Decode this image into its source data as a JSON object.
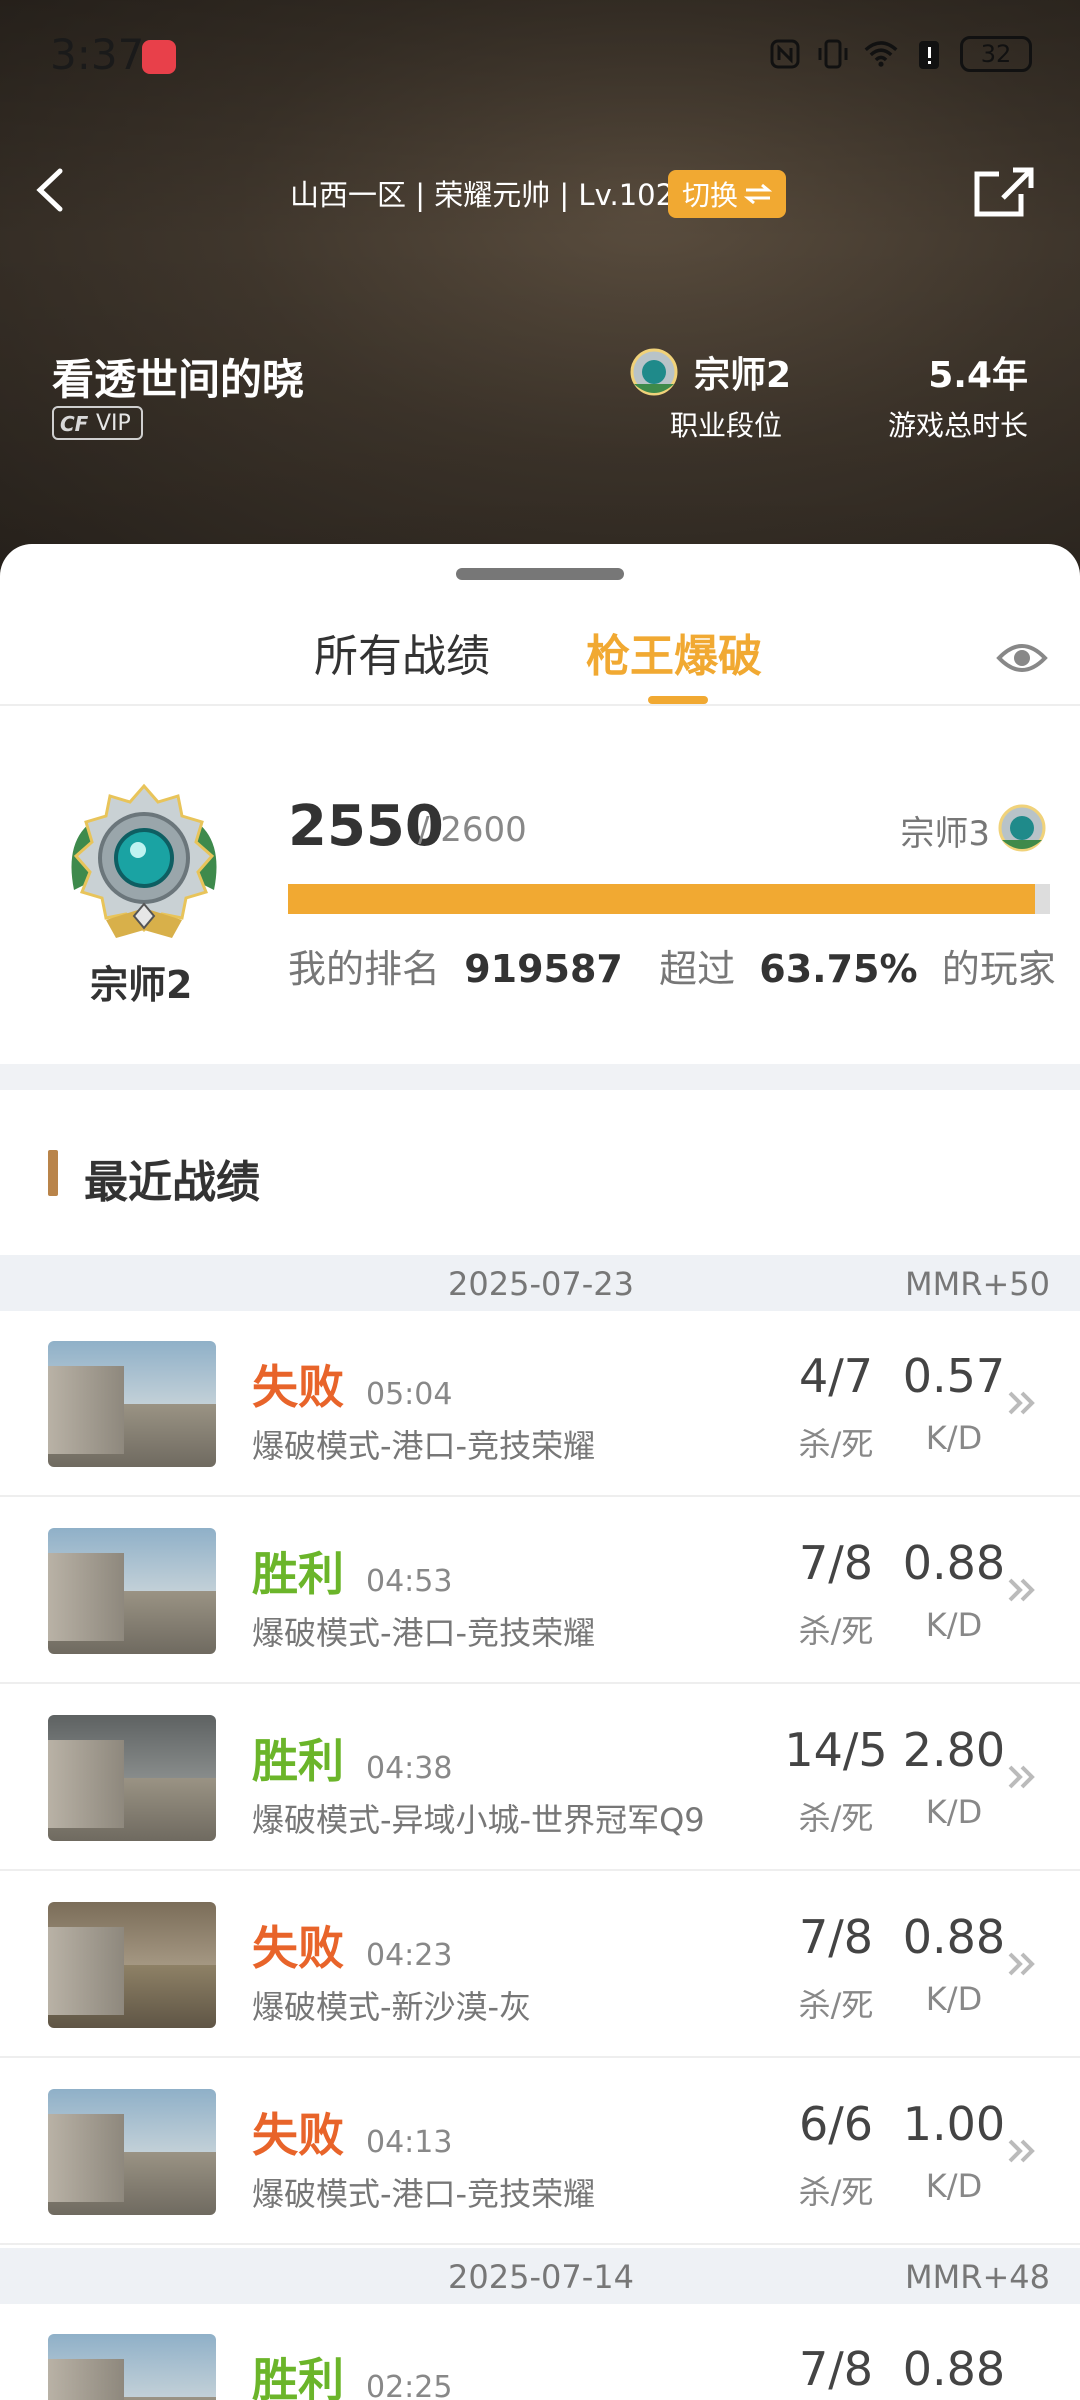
{
  "status_bar": {
    "time": "3:37",
    "battery": "32"
  },
  "header": {
    "server_info": "山西一区 | 荣耀元帅 | Lv.102",
    "switch_label": "切换",
    "player_name": "看透世间的晓",
    "vip_label": "VIP",
    "vip_prefix": "CF",
    "rank_value": "宗师2",
    "rank_label": "职业段位",
    "playtime_value": "5.4年",
    "playtime_label": "游戏总时长"
  },
  "tabs": [
    {
      "label": "所有战绩",
      "active": false
    },
    {
      "label": "枪王爆破",
      "active": true
    }
  ],
  "rank_panel": {
    "current_rank": "宗师2",
    "score": "2550",
    "score_max": "/ 2600",
    "next_rank": "宗师3",
    "progress_fraction": 0.98,
    "rank_prefix": "我的排名",
    "rank_number": "919587",
    "exceed_prefix": "超过",
    "exceed_percent": "63.75%",
    "exceed_suffix": "的玩家"
  },
  "recent": {
    "title": "最近战绩",
    "groups": [
      {
        "date": "2025-07-23",
        "mmr": "MMR+50",
        "matches": [
          {
            "result": "失败",
            "outcome": "lose",
            "time": "05:04",
            "mode": "爆破模式-港口-竞技荣耀",
            "kd_count": "4/7",
            "kd_count_label": "杀/死",
            "kd_ratio": "0.57",
            "kd_ratio_label": "K/D",
            "map": "port"
          },
          {
            "result": "胜利",
            "outcome": "win",
            "time": "04:53",
            "mode": "爆破模式-港口-竞技荣耀",
            "kd_count": "7/8",
            "kd_count_label": "杀/死",
            "kd_ratio": "0.88",
            "kd_ratio_label": "K/D",
            "map": "port"
          },
          {
            "result": "胜利",
            "outcome": "win",
            "time": "04:38",
            "mode": "爆破模式-异域小城-世界冠军Q9",
            "kd_count": "14/5",
            "kd_count_label": "杀/死",
            "kd_ratio": "2.80",
            "kd_ratio_label": "K/D",
            "map": "indoor"
          },
          {
            "result": "失败",
            "outcome": "lose",
            "time": "04:23",
            "mode": "爆破模式-新沙漠-灰",
            "kd_count": "7/8",
            "kd_count_label": "杀/死",
            "kd_ratio": "0.88",
            "kd_ratio_label": "K/D",
            "map": "desert"
          },
          {
            "result": "失败",
            "outcome": "lose",
            "time": "04:13",
            "mode": "爆破模式-港口-竞技荣耀",
            "kd_count": "6/6",
            "kd_count_label": "杀/死",
            "kd_ratio": "1.00",
            "kd_ratio_label": "K/D",
            "map": "port"
          }
        ]
      },
      {
        "date": "2025-07-14",
        "mmr": "MMR+48",
        "matches": [
          {
            "result": "胜利",
            "outcome": "win",
            "time": "02:25",
            "kd_count": "7/8",
            "kd_ratio": "0.88",
            "map": "port"
          }
        ]
      }
    ]
  },
  "colors": {
    "accent": "#f1a932",
    "lose": "#e8642a",
    "win": "#6bb52a"
  }
}
